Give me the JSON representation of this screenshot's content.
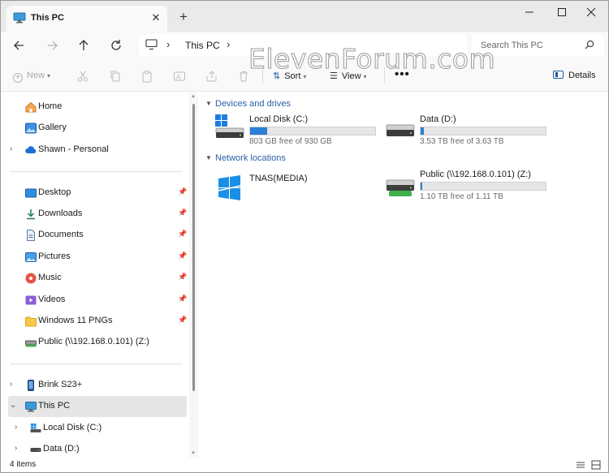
{
  "tab": {
    "title": "This PC",
    "close_glyph": "✕",
    "new_tab_glyph": "+"
  },
  "window_controls": {
    "minimize": "minimize-icon",
    "maximize": "maximize-icon",
    "close": "close-icon"
  },
  "address": {
    "path_label": "This PC",
    "separator": "›"
  },
  "search": {
    "placeholder": "Search This PC"
  },
  "commands": {
    "new_label": "New",
    "sort_label": "Sort",
    "view_label": "View",
    "more_label": "•••",
    "details_label": "Details"
  },
  "watermark": "ElevenForum.com",
  "sidebar": {
    "quick": [
      {
        "label": "Home",
        "icon": "home-icon"
      },
      {
        "label": "Gallery",
        "icon": "gallery-icon"
      },
      {
        "label": "Shawn - Personal",
        "icon": "cloud-icon",
        "expand": "›"
      }
    ],
    "pinned": [
      {
        "label": "Desktop",
        "icon": "desktop-icon"
      },
      {
        "label": "Downloads",
        "icon": "downloads-icon"
      },
      {
        "label": "Documents",
        "icon": "documents-icon"
      },
      {
        "label": "Pictures",
        "icon": "pictures-icon"
      },
      {
        "label": "Music",
        "icon": "music-icon"
      },
      {
        "label": "Videos",
        "icon": "videos-icon"
      },
      {
        "label": "Windows 11 PNGs",
        "icon": "folder-icon"
      },
      {
        "label": "Public (\\\\192.168.0.101) (Z:)",
        "icon": "network-drive-icon",
        "pinned": false
      }
    ],
    "devices": [
      {
        "label": "Brink S23+",
        "icon": "phone-icon",
        "expand": "›"
      },
      {
        "label": "This PC",
        "icon": "this-pc-icon",
        "expand": "⌄",
        "selected": true
      },
      {
        "label": "Local Disk (C:)",
        "icon": "windows-drive-icon",
        "expand": "›"
      },
      {
        "label": "Data (D:)",
        "icon": "drive-icon",
        "expand": "›"
      }
    ]
  },
  "groups": {
    "devices": {
      "label": "Devices and drives"
    },
    "network": {
      "label": "Network locations"
    }
  },
  "drives": [
    {
      "name": "Local Disk (C:)",
      "free_text": "803 GB free of 930 GB",
      "used_fraction": 0.137,
      "icon": "windows-drive-icon"
    },
    {
      "name": "Data (D:)",
      "free_text": "3.53 TB free of 3.63 TB",
      "used_fraction": 0.028,
      "icon": "drive-icon"
    },
    {
      "name": "TNAS(MEDIA)",
      "icon": "windows-network-icon"
    },
    {
      "name": "Public (\\\\192.168.0.101) (Z:)",
      "free_text": "1.10 TB free of 1.11 TB",
      "used_fraction": 0.009,
      "icon": "network-drive-icon"
    }
  ],
  "status": {
    "items_text": "4 items"
  },
  "colors": {
    "accent": "#2a7fd4",
    "group_header": "#2a5fa8",
    "selection": "#e6e6e6"
  }
}
